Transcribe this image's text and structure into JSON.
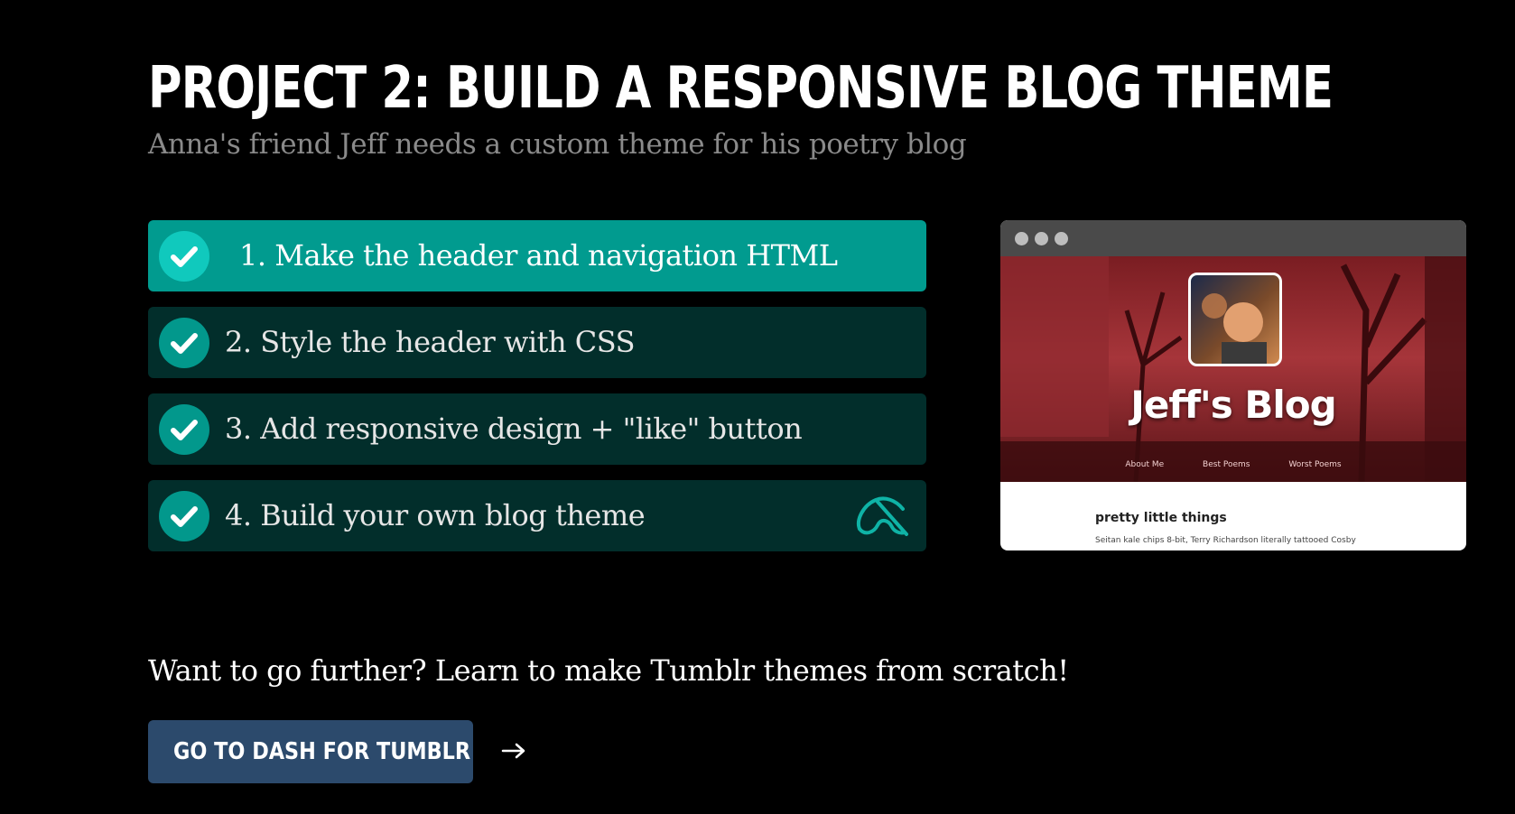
{
  "header": {
    "title": "PROJECT 2: BUILD A RESPONSIVE BLOG THEME",
    "subtitle": "Anna's friend Jeff needs a custom theme for his poetry blog"
  },
  "steps": [
    {
      "label": "1. Make the header and navigation HTML",
      "completed": true,
      "active": true
    },
    {
      "label": "2. Style the header with CSS",
      "completed": true,
      "active": false
    },
    {
      "label": "3. Add responsive design + \"like\" button",
      "completed": true,
      "active": false
    },
    {
      "label": "4. Build your own blog theme",
      "completed": true,
      "active": false,
      "icon": "external-project-icon"
    }
  ],
  "preview": {
    "blog_title": "Jeff's Blog",
    "nav": [
      "About Me",
      "Best Poems",
      "Worst Poems"
    ],
    "post_title": "pretty little things",
    "post_text": "Seitan kale chips 8-bit, Terry Richardson literally tattooed Cosby"
  },
  "footer": {
    "prompt": "Want to go further? Learn to make Tumblr themes from scratch!",
    "cta_label": "GO TO DASH FOR TUMBLR",
    "cta_icon": "arrow-right-icon"
  },
  "colors": {
    "background": "#000000",
    "step_active": "#019b8f",
    "step_inactive": "#022e2b",
    "check_circle": "#02988c",
    "cta": "#2c4a6c"
  }
}
